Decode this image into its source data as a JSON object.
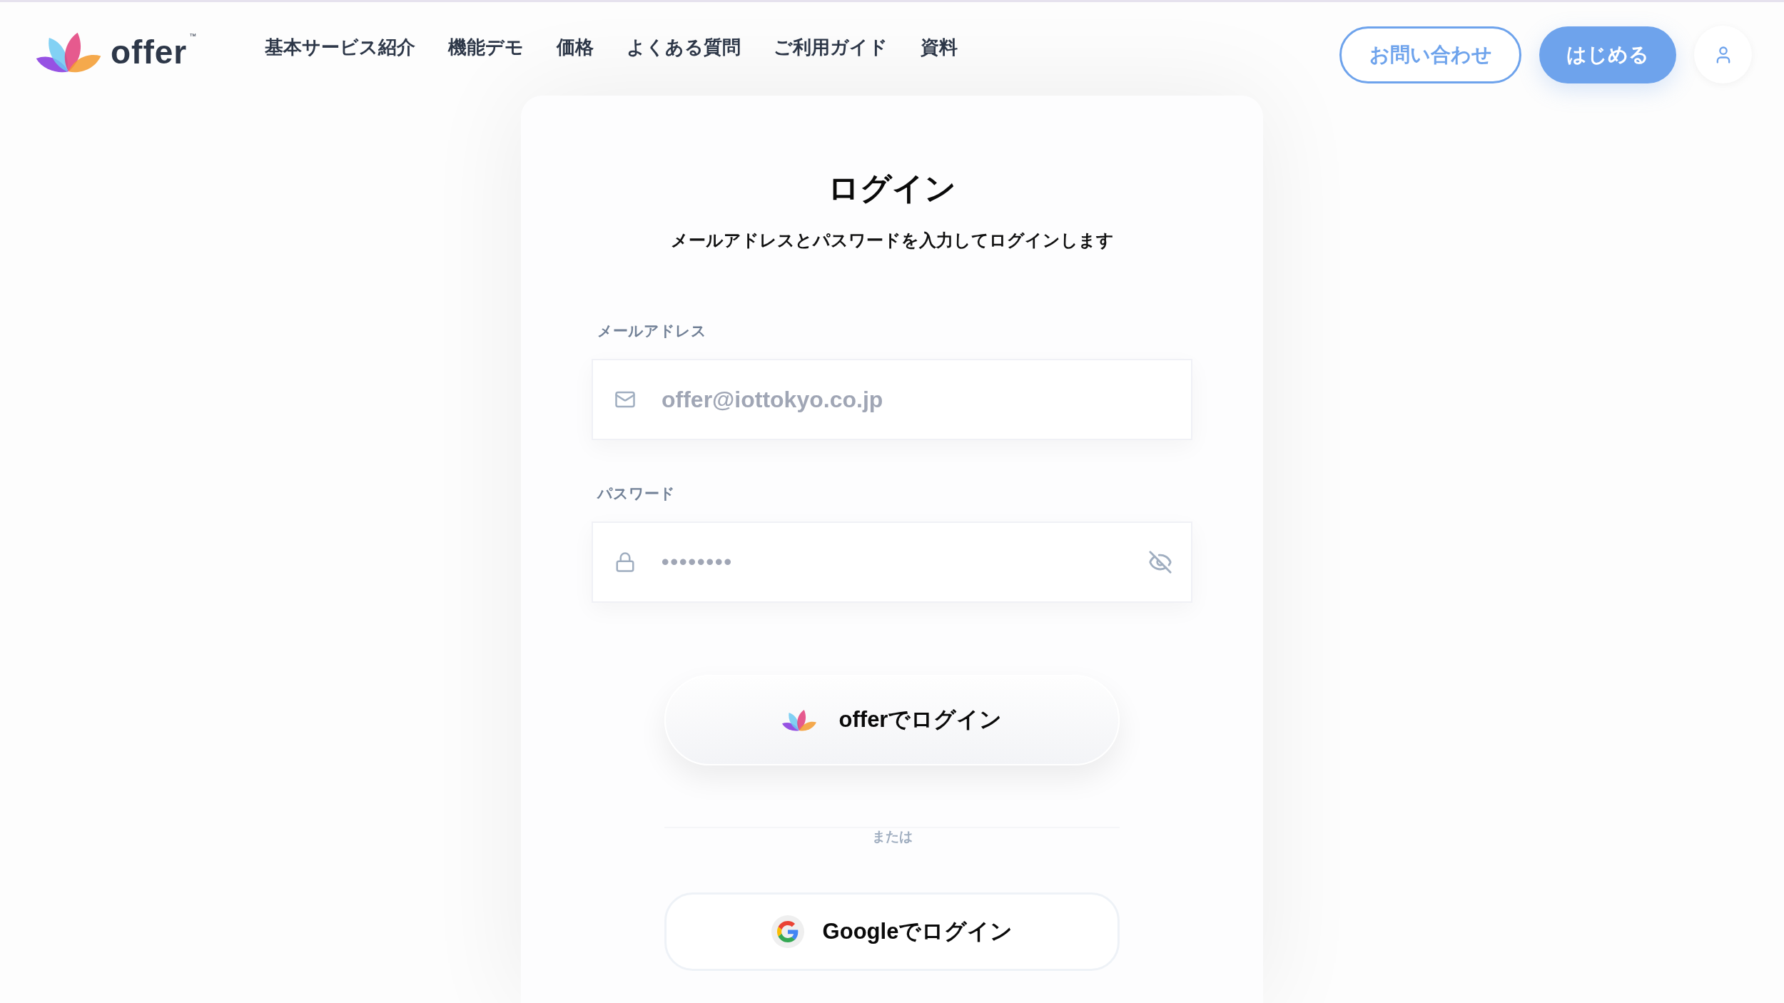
{
  "header": {
    "logo": {
      "name": "offer",
      "trademark": "™"
    },
    "nav": [
      "基本サービス紹介",
      "機能デモ",
      "価格",
      "よくある質問",
      "ご利用ガイド",
      "資料"
    ],
    "buttons": [
      {
        "kind": "outline",
        "label": "お問い合わせ"
      },
      {
        "kind": "filled",
        "label": "はじめる"
      }
    ]
  },
  "login": {
    "title": "ログイン",
    "subtitle": "メールアドレスとパスワードを入力してログインします",
    "fields": [
      {
        "kind": "email",
        "label": "メールアドレス",
        "placeholder": "offer@iottokyo.co.jp"
      },
      {
        "kind": "password",
        "label": "パスワード",
        "placeholder": "••••••••"
      }
    ],
    "primary_button": {
      "label": "offerでログイン"
    },
    "divider": "または",
    "google_button": {
      "label": "Googleでログイン"
    }
  }
}
